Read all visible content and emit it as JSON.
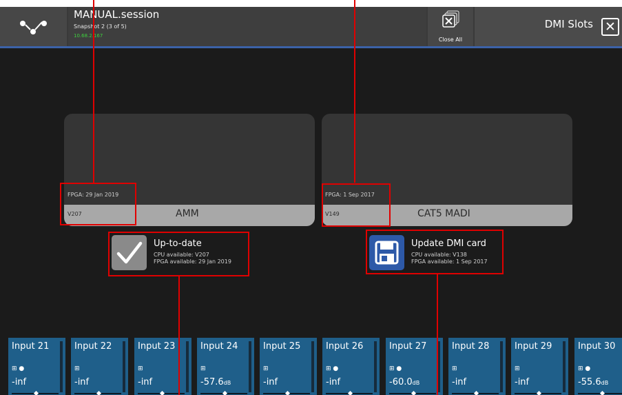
{
  "header": {
    "session_title": "MANUAL.session",
    "session_subtitle": "Snapshot 2 (3 of 5)",
    "session_ip": "10.68.2.167",
    "close_all_label": "Close All",
    "panel_title": "DMI Slots"
  },
  "cards": [
    {
      "fpga": "FPGA: 29 Jan 2019",
      "version": "V207",
      "name": "AMM"
    },
    {
      "fpga": "FPGA: 1 Sep 2017",
      "version": "V149",
      "name": "CAT5 MADI"
    }
  ],
  "status": [
    {
      "title": "Up-to-date",
      "cpu": "CPU available: V207",
      "fpga": "FPGA available: 29 Jan 2019",
      "icon": "checkmark-icon"
    },
    {
      "title": "Update DMI card",
      "cpu": "CPU available: V138",
      "fpga": "FPGA available: 1 Sep 2017",
      "icon": "floppy-disk-icon"
    }
  ],
  "strips": [
    {
      "label": "Input 21",
      "value": "-inf",
      "unit": ""
    },
    {
      "label": "Input 22",
      "value": "-inf",
      "unit": ""
    },
    {
      "label": "Input 23",
      "value": "-inf",
      "unit": ""
    },
    {
      "label": "Input 24",
      "value": "-57.6",
      "unit": "dB"
    },
    {
      "label": "Input 25",
      "value": "-inf",
      "unit": ""
    },
    {
      "label": "Input 26",
      "value": "-inf",
      "unit": ""
    },
    {
      "label": "Input 27",
      "value": "-60.0",
      "unit": "dB"
    },
    {
      "label": "Input 28",
      "value": "-inf",
      "unit": ""
    },
    {
      "label": "Input 29",
      "value": "-inf",
      "unit": ""
    },
    {
      "label": "Input 30",
      "value": "-55.6",
      "unit": "dB"
    }
  ],
  "colors": {
    "accent": "#3c62a8",
    "strip": "#1f5f8a",
    "annotation": "#e00000",
    "ip_text": "#3ed13e"
  }
}
